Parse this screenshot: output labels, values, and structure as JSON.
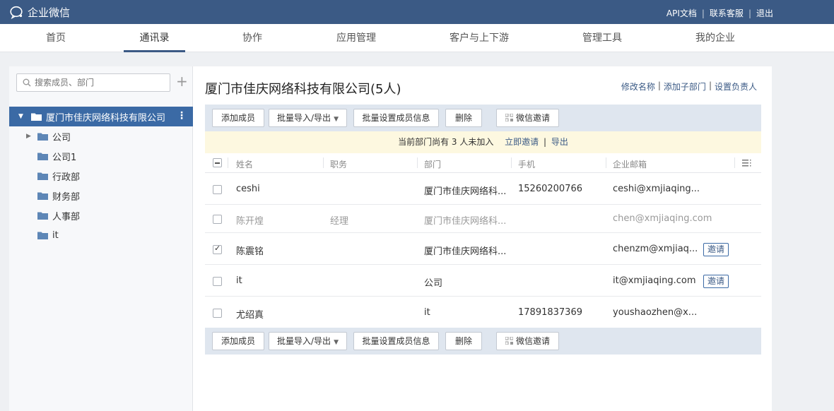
{
  "app": {
    "name": "企业微信"
  },
  "top_links": [
    "API文档",
    "联系客服",
    "退出"
  ],
  "nav": {
    "tabs": [
      {
        "label": "首页"
      },
      {
        "label": "通讯录"
      },
      {
        "label": "协作"
      },
      {
        "label": "应用管理"
      },
      {
        "label": "客户与上下游"
      },
      {
        "label": "管理工具"
      },
      {
        "label": "我的企业"
      }
    ],
    "active": "通讯录"
  },
  "sidebar": {
    "search_placeholder": "搜索成员、部门",
    "root": "厦门市佳庆网络科技有限公司",
    "items": [
      {
        "label": "公司",
        "expandable": true
      },
      {
        "label": "公司1"
      },
      {
        "label": "行政部"
      },
      {
        "label": "财务部"
      },
      {
        "label": "人事部"
      },
      {
        "label": "it"
      }
    ]
  },
  "main": {
    "title": "厦门市佳庆网络科技有限公司(5人)",
    "actions": [
      "修改名称",
      "添加子部门",
      "设置负责人"
    ],
    "toolbar": {
      "add": "添加成员",
      "import_export": "批量导入/导出",
      "batch_set": "批量设置成员信息",
      "delete": "删除",
      "wechat_invite": "微信邀请"
    },
    "notice": {
      "text": "当前部门尚有 3 人未加入",
      "join_now": "立即邀请",
      "export": "导出"
    },
    "columns": [
      "姓名",
      "职务",
      "部门",
      "手机",
      "企业邮箱"
    ],
    "rows": [
      {
        "name": "ceshi",
        "title": "",
        "dept": "厦门市佳庆网络科...",
        "phone": "15260200766",
        "email": "ceshi@xmjiaqing...",
        "checked": false,
        "muted": false,
        "invite": ""
      },
      {
        "name": "陈开煌",
        "title": "经理",
        "dept": "厦门市佳庆网络科...",
        "phone": "",
        "email": "chen@xmjiaqing.com",
        "checked": false,
        "muted": true,
        "invite": ""
      },
      {
        "name": "陈震铭",
        "title": "",
        "dept": "厦门市佳庆网络科...",
        "phone": "",
        "email": "chenzm@xmjiaq...",
        "checked": true,
        "muted": false,
        "invite": "邀请"
      },
      {
        "name": "it",
        "title": "",
        "dept": "公司",
        "phone": "",
        "email": "it@xmjiaqing.com",
        "checked": false,
        "muted": false,
        "invite": "邀请"
      },
      {
        "name": "尤绍真",
        "title": "",
        "dept": "it",
        "phone": "17891837369",
        "email": "youshaozhen@x...",
        "checked": false,
        "muted": false,
        "invite": ""
      }
    ]
  },
  "colors": {
    "topbar": "#3b5a85",
    "selected": "#3b6aa5",
    "toolbar": "#dfe6ef",
    "notice": "#fdf8e0"
  }
}
